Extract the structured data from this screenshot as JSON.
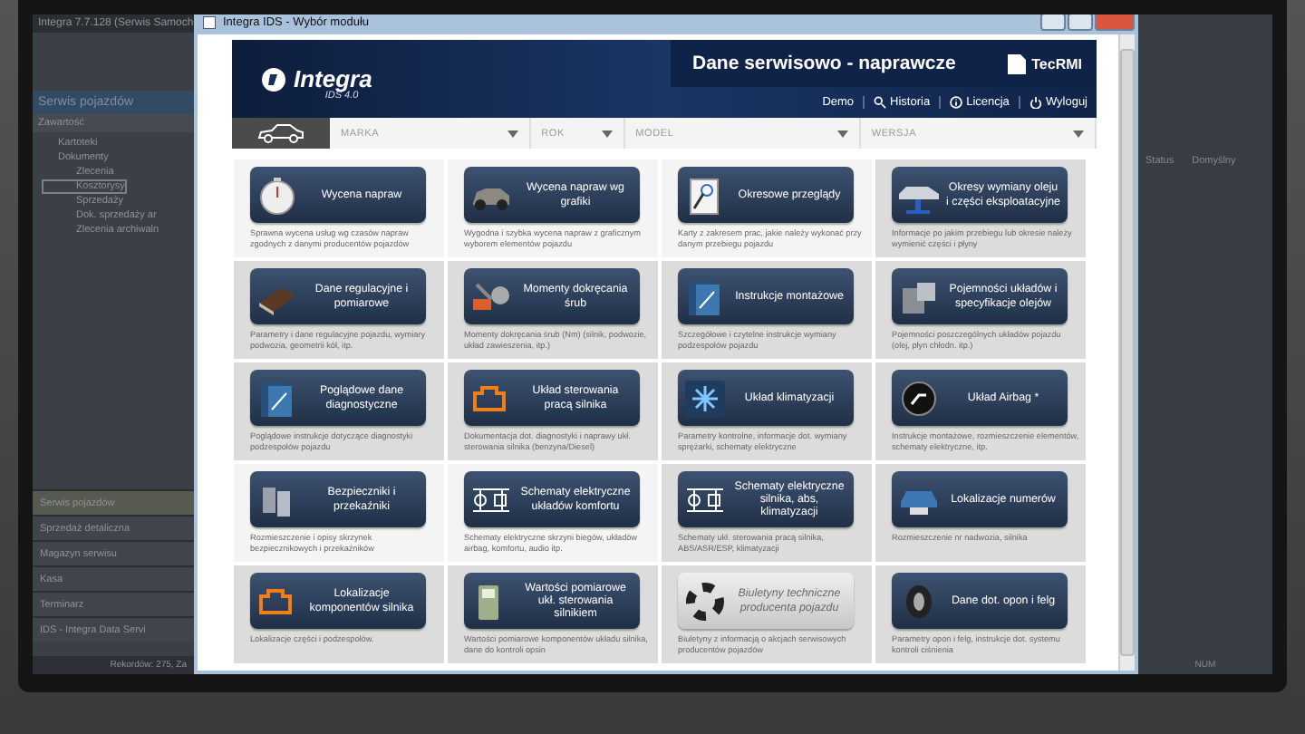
{
  "background_app": {
    "title": "Integra 7.7.128 (Serwis Samoch",
    "panel_title": "Serwis pojazdów",
    "tree_header": "Zawartość",
    "tree": [
      {
        "label": "Kartoteki",
        "selected": false
      },
      {
        "label": "Dokumenty",
        "selected": false,
        "children": [
          {
            "label": "Zlecenia",
            "selected": false
          },
          {
            "label": "Kosztorysy",
            "selected": true
          },
          {
            "label": "Sprzedaży",
            "selected": false
          },
          {
            "label": "Dok. sprzedaży ar",
            "selected": false
          },
          {
            "label": "Zlecenia archiwaln",
            "selected": false
          }
        ]
      }
    ],
    "nav_items": [
      {
        "label": "Serwis pojazdów",
        "selected": true
      },
      {
        "label": "Sprzedaż detaliczna",
        "selected": false
      },
      {
        "label": "Magazyn serwisu",
        "selected": false
      },
      {
        "label": "Kasa",
        "selected": false
      },
      {
        "label": "Terminarz",
        "selected": false
      },
      {
        "label": "IDS - Integra Data Servi",
        "selected": false
      }
    ],
    "status": "Rekordów: 275, Za",
    "right_labels": [
      "Status",
      "Domyślny"
    ],
    "right_status": "NUM"
  },
  "dialog": {
    "title": "Integra IDS - Wybór modułu",
    "banner": {
      "logo": "Integra",
      "version": "IDS 4.0",
      "heading": "Dane serwisowo - naprawcze",
      "partner": "TecRMI",
      "links": [
        "Demo",
        "Historia",
        "Licencja",
        "Wyloguj"
      ]
    },
    "filters": [
      {
        "placeholder": "MARKA"
      },
      {
        "placeholder": "ROK"
      },
      {
        "placeholder": "MODEL"
      },
      {
        "placeholder": "WERSJA"
      }
    ],
    "modules": [
      {
        "label": "Wycena napraw",
        "description": "Sprawna wycena usług wg czasów napraw zgodnych z danymi producentów pojazdów",
        "highlighted": true,
        "disabled": false
      },
      {
        "label": "Wycena napraw wg grafiki",
        "description": "Wygodna i szybka wycena napraw z graficznym wyborem elementów pojazdu",
        "highlighted": true,
        "disabled": false
      },
      {
        "label": "Okresowe przeglądy",
        "description": "Karty z zakresem prac, jakie należy wykonać przy danym przebiegu pojazdu",
        "highlighted": true,
        "disabled": false
      },
      {
        "label": "Okresy wymiany oleju i części eksploatacyjne",
        "description": "Informacje po jakim przebiegu lub okresie należy wymienić części i płyny",
        "highlighted": false,
        "disabled": false
      },
      {
        "label": "Dane regulacyjne i pomiarowe",
        "description": "Parametry i dane regulacyjne pojazdu, wymiary podwozia, geometrii kół, itp.",
        "highlighted": false,
        "disabled": false
      },
      {
        "label": "Momenty dokręcania śrub",
        "description": "Momenty dokręcania śrub (Nm) (silnik, podwozie, układ zawieszenia, itp.)",
        "highlighted": false,
        "disabled": false
      },
      {
        "label": "Instrukcje montażowe",
        "description": "Szczegółowe i czytelne instrukcje wymiany podzespołów pojazdu",
        "highlighted": false,
        "disabled": false
      },
      {
        "label": "Pojemności układów i specyfikacje olejów",
        "description": "Pojemności poszczególnych układów pojazdu (olej, płyn chłodn. itp.)",
        "highlighted": false,
        "disabled": false
      },
      {
        "label": "Poglądowe dane diagnostyczne",
        "description": "Poglądowe instrukcje dotyczące diagnostyki podzespołów pojazdu",
        "highlighted": false,
        "disabled": false
      },
      {
        "label": "Układ sterowania pracą silnika",
        "description": "Dokumentacja dot. diagnostyki i naprawy ukł. sterowania silnika (benzyna/Diesel)",
        "highlighted": false,
        "disabled": false
      },
      {
        "label": "Układ klimatyzacji",
        "description": "Parametry kontrolne, informacje dot. wymiany sprężarki, schematy elektryczne",
        "highlighted": false,
        "disabled": false
      },
      {
        "label": "Układ Airbag *",
        "description": "Instrukcje montażowe, rozmieszczenie elementów, schematy elektryczne, itp.",
        "highlighted": false,
        "disabled": false
      },
      {
        "label": "Bezpieczniki i przekaźniki",
        "description": "Rozmieszczenie i opisy skrzynek bezpiecznikowych i przekaźników",
        "highlighted": true,
        "disabled": false
      },
      {
        "label": "Schematy elektryczne układów komfortu",
        "description": "Schematy elektryczne skrzyni biegów, układów airbag, komfortu, audio itp.",
        "highlighted": true,
        "disabled": false
      },
      {
        "label": "Schematy elektryczne silnika, abs, klimatyzacji",
        "description": "Schematy ukł. sterowania pracą silnika, ABS/ASR/ESP, klimatyzacji",
        "highlighted": false,
        "disabled": false
      },
      {
        "label": "Lokalizacje numerów",
        "description": "Rozmieszczenie nr nadwozia, silnika",
        "highlighted": false,
        "disabled": false
      },
      {
        "label": "Lokalizacje komponentów silnika",
        "description": "Lokalizacje części i podzespołów.",
        "highlighted": false,
        "disabled": false
      },
      {
        "label": "Wartości pomiarowe ukł. sterowania silnikiem",
        "description": "Wartości pomiarowe komponentów układu silnika, dane do kontroli opsin",
        "highlighted": false,
        "disabled": false
      },
      {
        "label": "Biuletyny techniczne producenta pojazdu",
        "description": "Biuletyny z informacją o akcjach serwisowych producentów pojazdów",
        "highlighted": false,
        "disabled": true
      },
      {
        "label": "Dane dot. opon i felg",
        "description": "Parametry opon i felg, instrukcje dot. systemu kontroli ciśnienia",
        "highlighted": false,
        "disabled": false
      }
    ]
  }
}
